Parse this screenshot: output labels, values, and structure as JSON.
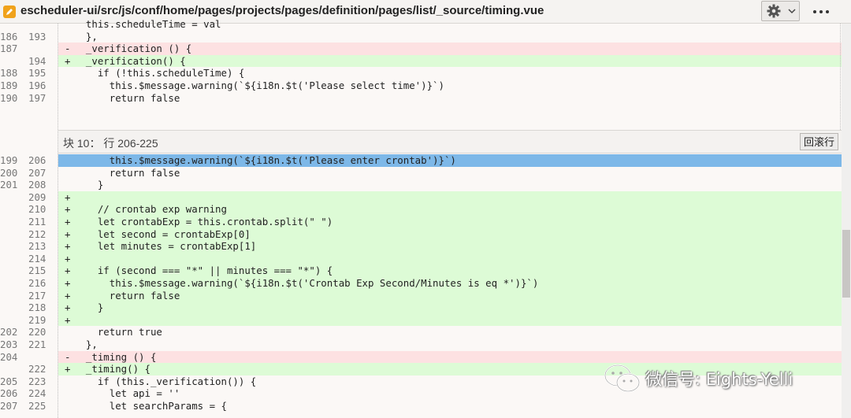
{
  "header": {
    "file_path": "escheduler-ui/src/js/conf/home/pages/projects/pages/definition/pages/list/_source/timing.vue",
    "icons": [
      "file-edit-icon",
      "gear-icon",
      "chevron-down-icon",
      "more-icon"
    ]
  },
  "hunk_top": [
    {
      "old": "",
      "new": "",
      "mark": "",
      "code": "  this.scheduleTime = val",
      "type": "ctx"
    },
    {
      "old": "186",
      "new": "193",
      "mark": "",
      "code": "  },",
      "type": "ctx"
    },
    {
      "old": "187",
      "new": "",
      "mark": "-",
      "code": "  _verification () {",
      "type": "del"
    },
    {
      "old": "",
      "new": "194",
      "mark": "+",
      "code": "  _verification() {",
      "type": "add"
    },
    {
      "old": "188",
      "new": "195",
      "mark": "",
      "code": "    if (!this.scheduleTime) {",
      "type": "ctx"
    },
    {
      "old": "189",
      "new": "196",
      "mark": "",
      "code": "      this.$message.warning(`${i18n.$t('Please select time')}`)",
      "type": "ctx"
    },
    {
      "old": "190",
      "new": "197",
      "mark": "",
      "code": "      return false",
      "type": "ctx"
    }
  ],
  "hunk_sep": {
    "label": "块 10： 行 206-225",
    "revert_label": "回滚行"
  },
  "hunk_bottom": [
    {
      "old": "199",
      "new": "206",
      "mark": "",
      "code": "      this.$message.warning(`${i18n.$t('Please enter crontab')}`)",
      "type": "sel"
    },
    {
      "old": "200",
      "new": "207",
      "mark": "",
      "code": "      return false",
      "type": "ctx"
    },
    {
      "old": "201",
      "new": "208",
      "mark": "",
      "code": "    }",
      "type": "ctx"
    },
    {
      "old": "",
      "new": "209",
      "mark": "+",
      "code": "",
      "type": "add"
    },
    {
      "old": "",
      "new": "210",
      "mark": "+",
      "code": "    // crontab exp warning",
      "type": "add"
    },
    {
      "old": "",
      "new": "211",
      "mark": "+",
      "code": "    let crontabExp = this.crontab.split(\" \")",
      "type": "add"
    },
    {
      "old": "",
      "new": "212",
      "mark": "+",
      "code": "    let second = crontabExp[0]",
      "type": "add"
    },
    {
      "old": "",
      "new": "213",
      "mark": "+",
      "code": "    let minutes = crontabExp[1]",
      "type": "add"
    },
    {
      "old": "",
      "new": "214",
      "mark": "+",
      "code": "",
      "type": "add"
    },
    {
      "old": "",
      "new": "215",
      "mark": "+",
      "code": "    if (second === \"*\" || minutes === \"*\") {",
      "type": "add"
    },
    {
      "old": "",
      "new": "216",
      "mark": "+",
      "code": "      this.$message.warning(`${i18n.$t('Crontab Exp Second/Minutes is eq *')}`)",
      "type": "add"
    },
    {
      "old": "",
      "new": "217",
      "mark": "+",
      "code": "      return false",
      "type": "add"
    },
    {
      "old": "",
      "new": "218",
      "mark": "+",
      "code": "    }",
      "type": "add"
    },
    {
      "old": "",
      "new": "219",
      "mark": "+",
      "code": "",
      "type": "add"
    },
    {
      "old": "202",
      "new": "220",
      "mark": "",
      "code": "    return true",
      "type": "ctx"
    },
    {
      "old": "203",
      "new": "221",
      "mark": "",
      "code": "  },",
      "type": "ctx"
    },
    {
      "old": "204",
      "new": "",
      "mark": "-",
      "code": "  _timing () {",
      "type": "del"
    },
    {
      "old": "",
      "new": "222",
      "mark": "+",
      "code": "  _timing() {",
      "type": "add"
    },
    {
      "old": "205",
      "new": "223",
      "mark": "",
      "code": "    if (this._verification()) {",
      "type": "ctx"
    },
    {
      "old": "206",
      "new": "224",
      "mark": "",
      "code": "      let api = ''",
      "type": "ctx"
    },
    {
      "old": "207",
      "new": "225",
      "mark": "",
      "code": "      let searchParams = {",
      "type": "ctx"
    }
  ],
  "watermark": {
    "text": "微信号: Eights-Yelli",
    "icon": "wechat-icon"
  }
}
